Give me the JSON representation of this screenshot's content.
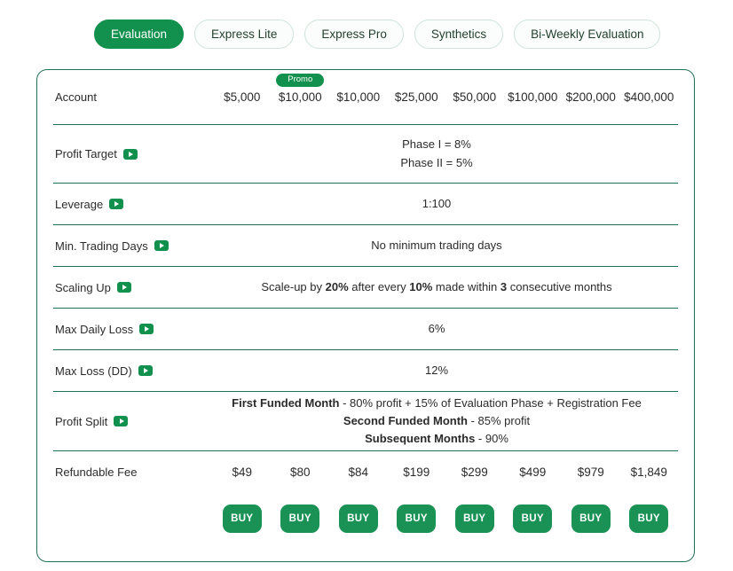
{
  "tabs": [
    {
      "label": "Evaluation",
      "active": true
    },
    {
      "label": "Express Lite",
      "active": false
    },
    {
      "label": "Express Pro",
      "active": false
    },
    {
      "label": "Synthetics",
      "active": false
    },
    {
      "label": "Bi-Weekly Evaluation",
      "active": false
    }
  ],
  "colors": {
    "brand_green": "#12904d",
    "buy_green": "#1a9255",
    "border_green": "#1f6e55",
    "tab_inactive_border": "#cfe3d8",
    "text": "#2b2b2b"
  },
  "table": {
    "account": {
      "label": "Account",
      "promo_badge": "Promo",
      "columns": [
        {
          "value": "$5,000",
          "promo": false
        },
        {
          "value": "$10,000",
          "promo": true
        },
        {
          "value": "$10,000",
          "promo": false
        },
        {
          "value": "$25,000",
          "promo": false
        },
        {
          "value": "$50,000",
          "promo": false
        },
        {
          "value": "$100,000",
          "promo": false
        },
        {
          "value": "$200,000",
          "promo": false
        },
        {
          "value": "$400,000",
          "promo": false
        }
      ]
    },
    "profit_target": {
      "label": "Profit Target",
      "has_video": true,
      "line1": "Phase I = 8%",
      "line2": "Phase II = 5%"
    },
    "leverage": {
      "label": "Leverage",
      "has_video": true,
      "value": "1:100"
    },
    "min_trading_days": {
      "label": "Min. Trading Days",
      "has_video": true,
      "value": "No minimum trading days"
    },
    "scaling_up": {
      "label": "Scaling Up",
      "has_video": true,
      "t1": "Scale-up by ",
      "b1": "20%",
      "t2": " after every ",
      "b2": "10%",
      "t3": " made within ",
      "b3": "3",
      "t4": " consecutive months"
    },
    "max_daily_loss": {
      "label": "Max Daily Loss",
      "has_video": true,
      "value": "6%"
    },
    "max_loss_dd": {
      "label": "Max Loss (DD)",
      "has_video": true,
      "value": "12%"
    },
    "profit_split": {
      "label": "Profit Split",
      "has_video": true,
      "l1_bold": "First Funded Month",
      "l1_rest": " - 80% profit + 15% of Evaluation Phase + Registration Fee",
      "l2_bold": "Second Funded Month",
      "l2_rest": " - 85% profit",
      "l3_bold": "Subsequent Months",
      "l3_rest": " - 90%"
    },
    "refundable_fee": {
      "label": "Refundable Fee",
      "values": [
        "$49",
        "$80",
        "$84",
        "$199",
        "$299",
        "$499",
        "$979",
        "$1,849"
      ]
    },
    "buy": {
      "label": "BUY",
      "count": 8
    }
  }
}
